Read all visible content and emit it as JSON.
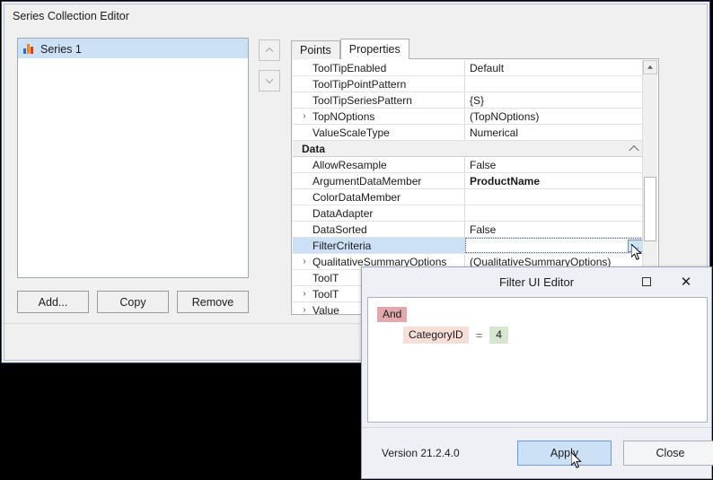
{
  "main_window": {
    "title": "Series Collection Editor",
    "series_list": {
      "items": [
        {
          "label": "Series 1",
          "icon": "bar-chart-icon",
          "selected": true
        }
      ]
    },
    "order_buttons": {
      "up": "chevron-up-icon",
      "down": "chevron-down-icon"
    },
    "list_buttons": {
      "add": "Add...",
      "copy": "Copy",
      "remove": "Remove"
    },
    "tabs": [
      {
        "label": "Points",
        "active": false
      },
      {
        "label": "Properties",
        "active": true
      }
    ],
    "property_grid": {
      "rows": [
        {
          "name": "ToolTipEnabled",
          "value": "Default",
          "expandable": false,
          "category": false,
          "bold": false,
          "selected": false,
          "editing": false
        },
        {
          "name": "ToolTipPointPattern",
          "value": "",
          "expandable": false,
          "category": false,
          "bold": false,
          "selected": false,
          "editing": false
        },
        {
          "name": "ToolTipSeriesPattern",
          "value": "{S}",
          "expandable": false,
          "category": false,
          "bold": false,
          "selected": false,
          "editing": false
        },
        {
          "name": "TopNOptions",
          "value": "(TopNOptions)",
          "expandable": true,
          "category": false,
          "bold": false,
          "selected": false,
          "editing": false
        },
        {
          "name": "ValueScaleType",
          "value": "Numerical",
          "expandable": false,
          "category": false,
          "bold": false,
          "selected": false,
          "editing": false
        },
        {
          "name": "Data",
          "value": "",
          "expandable": false,
          "category": true,
          "bold": false,
          "selected": false,
          "editing": false
        },
        {
          "name": "AllowResample",
          "value": "False",
          "expandable": false,
          "category": false,
          "bold": false,
          "selected": false,
          "editing": false
        },
        {
          "name": "ArgumentDataMember",
          "value": "ProductName",
          "expandable": false,
          "category": false,
          "bold": true,
          "selected": false,
          "editing": false
        },
        {
          "name": "ColorDataMember",
          "value": "",
          "expandable": false,
          "category": false,
          "bold": false,
          "selected": false,
          "editing": false
        },
        {
          "name": "DataAdapter",
          "value": "",
          "expandable": false,
          "category": false,
          "bold": false,
          "selected": false,
          "editing": false
        },
        {
          "name": "DataSorted",
          "value": "False",
          "expandable": false,
          "category": false,
          "bold": false,
          "selected": false,
          "editing": false
        },
        {
          "name": "FilterCriteria",
          "value": "",
          "expandable": false,
          "category": false,
          "bold": false,
          "selected": true,
          "editing": true,
          "ellipsis_label": "..."
        },
        {
          "name": "QualitativeSummaryOptions",
          "value": "(QualitativeSummaryOptions)",
          "expandable": true,
          "category": false,
          "bold": false,
          "selected": false,
          "editing": false
        },
        {
          "name": "ToolT",
          "value": "",
          "expandable": false,
          "category": false,
          "bold": false,
          "selected": false,
          "editing": false
        },
        {
          "name": "ToolT",
          "value": "",
          "expandable": true,
          "category": false,
          "bold": false,
          "selected": false,
          "editing": false
        },
        {
          "name": "Value",
          "value": "",
          "expandable": true,
          "category": false,
          "bold": false,
          "selected": false,
          "editing": false
        }
      ],
      "expander_glyph": "›",
      "scrollbar": {
        "up_arrow": "scroll-up-arrow-icon"
      }
    }
  },
  "filter_dialog": {
    "title": "Filter UI Editor",
    "titlebar_buttons": {
      "maximize": "maximize-icon",
      "close": "✕"
    },
    "expression": {
      "group_operator": "And",
      "condition": {
        "field": "CategoryID",
        "operator": "=",
        "value": "4"
      }
    },
    "version": "Version 21.2.4.0",
    "buttons": {
      "apply": "Apply",
      "close": "Close"
    }
  },
  "colors": {
    "selection_blue": "#cde1f6",
    "and_badge": "#e2a9ad",
    "field_badge": "#f6ded9",
    "value_badge": "#d6e6cf",
    "window_border": "#3b4a6b",
    "dialog_bg": "#eef0f5"
  }
}
